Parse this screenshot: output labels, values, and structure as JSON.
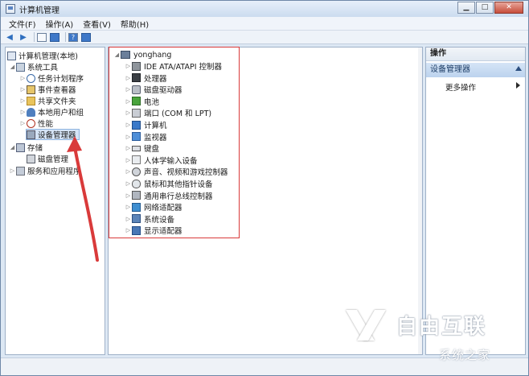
{
  "window": {
    "title": "计算机管理"
  },
  "menu": {
    "items": [
      "文件(F)",
      "操作(A)",
      "查看(V)",
      "帮助(H)"
    ]
  },
  "left_tree": {
    "root": "计算机管理(本地)",
    "system_tools": "系统工具",
    "items": [
      "任务计划程序",
      "事件查看器",
      "共享文件夹",
      "本地用户和组",
      "性能",
      "设备管理器"
    ],
    "storage": "存储",
    "disk_mgmt": "磁盘管理",
    "services": "服务和应用程序"
  },
  "device_tree": {
    "host": "yonghang",
    "categories": [
      "IDE ATA/ATAPI 控制器",
      "处理器",
      "磁盘驱动器",
      "电池",
      "端口 (COM 和 LPT)",
      "计算机",
      "监视器",
      "键盘",
      "人体学输入设备",
      "声音、视频和游戏控制器",
      "鼠标和其他指针设备",
      "通用串行总线控制器",
      "网络适配器",
      "系统设备",
      "显示适配器"
    ],
    "category_icons": [
      "ide-controller-icon",
      "processor-icon",
      "disk-drive-icon",
      "battery-icon",
      "port-icon",
      "computer-icon",
      "monitor-icon",
      "keyboard-icon",
      "hid-icon",
      "sound-icon",
      "mouse-icon",
      "usb-icon",
      "network-adapter-icon",
      "system-device-icon",
      "display-adapter-icon"
    ]
  },
  "actions": {
    "header": "操作",
    "section": "设备管理器",
    "more": "更多操作"
  },
  "watermark": {
    "brand": "自由互联",
    "small": "系统之家"
  },
  "colors": {
    "highlight_box": "#d93a3a",
    "annotation_arrow": "#d93a3a",
    "selection": "#d5e4f6"
  }
}
